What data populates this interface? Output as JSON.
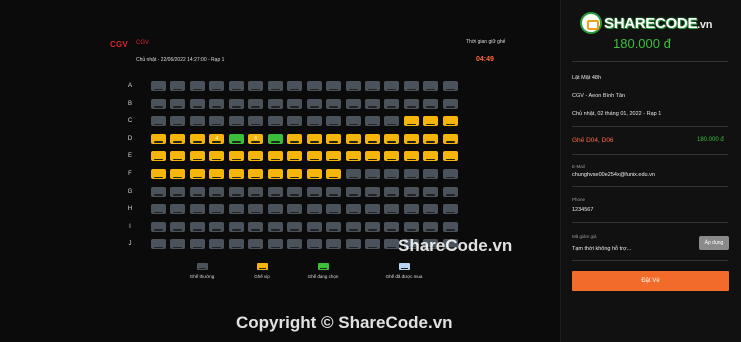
{
  "header": {
    "brand": "CGV",
    "brand_sub": "CGV",
    "showtime": "Chủ nhật - 22/06/2022 14:27:00 - Rạp 1",
    "timer_label": "Thời gian giữ ghế",
    "timer_value": "04:49"
  },
  "seat_map": {
    "rows": [
      "A",
      "B",
      "C",
      "D",
      "E",
      "F",
      "G",
      "H",
      "I",
      "J"
    ],
    "columns": 16,
    "seat_types": {
      "A": [
        "normal",
        "normal",
        "normal",
        "normal",
        "normal",
        "normal",
        "normal",
        "normal",
        "normal",
        "normal",
        "normal",
        "normal",
        "normal",
        "normal",
        "normal",
        "normal"
      ],
      "B": [
        "normal",
        "normal",
        "normal",
        "normal",
        "normal",
        "normal",
        "normal",
        "normal",
        "normal",
        "normal",
        "normal",
        "normal",
        "normal",
        "normal",
        "normal",
        "normal"
      ],
      "C": [
        "normal",
        "normal",
        "normal",
        "normal",
        "normal",
        "normal",
        "normal",
        "normal",
        "normal",
        "normal",
        "normal",
        "normal",
        "normal",
        "vip",
        "vip",
        "vip"
      ],
      "D": [
        "vip",
        "vip",
        "vip",
        "vip",
        "selected",
        "vip",
        "selected",
        "vip",
        "vip",
        "vip",
        "vip",
        "vip",
        "vip",
        "vip",
        "vip",
        "vip"
      ],
      "E": [
        "vip",
        "vip",
        "vip",
        "vip",
        "vip",
        "vip",
        "vip",
        "vip",
        "vip",
        "vip",
        "vip",
        "vip",
        "vip",
        "vip",
        "vip",
        "vip"
      ],
      "F": [
        "vip",
        "vip",
        "vip",
        "vip",
        "vip",
        "vip",
        "vip",
        "vip",
        "vip",
        "vip",
        "normal",
        "normal",
        "normal",
        "normal",
        "normal",
        "normal"
      ],
      "G": [
        "normal",
        "normal",
        "normal",
        "normal",
        "normal",
        "normal",
        "normal",
        "normal",
        "normal",
        "normal",
        "normal",
        "normal",
        "normal",
        "normal",
        "normal",
        "normal"
      ],
      "H": [
        "normal",
        "normal",
        "normal",
        "normal",
        "normal",
        "normal",
        "normal",
        "normal",
        "normal",
        "normal",
        "normal",
        "normal",
        "normal",
        "normal",
        "normal",
        "normal"
      ],
      "I": [
        "normal",
        "normal",
        "normal",
        "normal",
        "normal",
        "normal",
        "normal",
        "normal",
        "normal",
        "normal",
        "normal",
        "normal",
        "normal",
        "normal",
        "normal",
        "normal"
      ],
      "J": [
        "normal",
        "normal",
        "normal",
        "normal",
        "normal",
        "normal",
        "normal",
        "normal",
        "normal",
        "normal",
        "normal",
        "normal",
        "normal",
        "normal",
        "normal",
        "normal"
      ]
    },
    "seat_labels": {
      "D": {
        "4": "4",
        "6": "6"
      }
    },
    "colors": {
      "normal": "#4a535c",
      "vip": "#f5b50a",
      "selected": "#3bbf3b",
      "sold": "#b8d4f0"
    }
  },
  "legend": [
    {
      "type": "normal",
      "label": "Ghế thường"
    },
    {
      "type": "vip",
      "label": "Ghế vip"
    },
    {
      "type": "selected",
      "label": "Ghế đang chọn"
    },
    {
      "type": "sold",
      "label": "Ghế đã được mua"
    }
  ],
  "sidebar": {
    "logo_main": "SHARECODE",
    "logo_suffix": ".vn",
    "total": "180.000 đ",
    "movie": "Lật Mặt 48h",
    "cinema": "CGV - Aeon Bình Tân",
    "date": "Chủ nhật, 02 tháng 01, 2022 - Rạp 1",
    "seats_chosen": "Ghế D04, D06",
    "seats_price": "180.000 đ",
    "email_label": "E-Mail",
    "email_value": "chunghvse00e254x@funix.edu.vn",
    "phone_label": "Phone",
    "phone_value": "1234567",
    "promo_label": "Mã giảm giá",
    "promo_placeholder": "Tạm thời không hỗ trợ...",
    "apply_label": "Áp dụng",
    "book_label": "Đặt Vé"
  },
  "watermarks": {
    "center": "ShareCode.vn",
    "bottom": "Copyright © ShareCode.vn"
  }
}
